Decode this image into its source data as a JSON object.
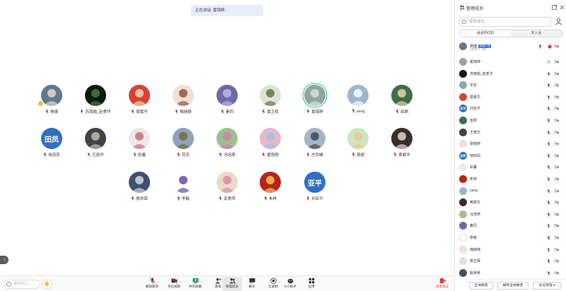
{
  "speaking_banner": "正在讲话: 夏锦婷;",
  "stage_tiles": [
    {
      "name": "杨捷",
      "mic": "muted",
      "avatar": {
        "kind": "photo",
        "bg": "#5e7a8f",
        "fg": "#e9d6c6"
      },
      "hand": true
    },
    {
      "name": "苏丽娟_赵季华",
      "mic": "on",
      "avatar": {
        "kind": "photo",
        "bg": "#0e1a10",
        "fg": "#3f7d3a"
      }
    },
    {
      "name": "梁慕华",
      "mic": "muted",
      "avatar": {
        "kind": "photo",
        "bg": "#d8432f",
        "fg": "#f3d3c0"
      }
    },
    {
      "name": "梅婉婧",
      "mic": "muted",
      "avatar": {
        "kind": "photo",
        "bg": "#f1dfd2",
        "fg": "#8a5a47"
      }
    },
    {
      "name": "秦同",
      "mic": "muted",
      "avatar": {
        "kind": "photo",
        "bg": "#6e6aa8",
        "fg": "#c3b7e0"
      }
    },
    {
      "name": "黄正辉",
      "mic": "muted",
      "avatar": {
        "kind": "photo",
        "bg": "#dfe3d6",
        "fg": "#5c7a3b"
      }
    },
    {
      "name": "夏锦婷",
      "mic": "on",
      "speaking": true,
      "avatar": {
        "kind": "photo",
        "bg": "#8fa7a0",
        "fg": "#d6e0d8"
      }
    },
    {
      "name": "yang",
      "mic": "muted",
      "avatar": {
        "kind": "photo",
        "bg": "#9cb7cf",
        "fg": "#ffffff"
      }
    },
    {
      "name": "巫刚",
      "mic": "muted",
      "avatar": {
        "kind": "photo",
        "bg": "#3d6f49",
        "fg": "#f1cfa8"
      }
    },
    {
      "name": "徐田凤",
      "mic": "muted",
      "avatar": {
        "kind": "text",
        "text": "田凤",
        "bg": "#2f6fc4"
      }
    },
    {
      "name": "王丽华",
      "mic": "muted",
      "avatar": {
        "kind": "photo",
        "bg": "#404447",
        "fg": "#c9b9a8"
      }
    },
    {
      "name": "彩馨",
      "mic": "muted",
      "avatar": {
        "kind": "photo",
        "bg": "#efe9e6",
        "fg": "#c56d7a"
      }
    },
    {
      "name": "花花",
      "mic": "muted",
      "avatar": {
        "kind": "photo",
        "bg": "#8aa4b8",
        "fg": "#7a6a3c"
      }
    },
    {
      "name": "冯培燕",
      "mic": "muted",
      "avatar": {
        "kind": "photo",
        "bg": "#9fbf8e",
        "fg": "#d77ca8"
      }
    },
    {
      "name": "童雨晴",
      "mic": "muted",
      "avatar": {
        "kind": "photo",
        "bg": "#e7b7c9",
        "fg": "#9bc5e2"
      }
    },
    {
      "name": "庄剑峰",
      "mic": "muted",
      "avatar": {
        "kind": "photo",
        "bg": "#a7b4c6",
        "fg": "#3d4856"
      }
    },
    {
      "name": "周超",
      "mic": "muted",
      "avatar": {
        "kind": "photo",
        "bg": "#cfe6c0",
        "fg": "#f2c590"
      }
    },
    {
      "name": "黄颖华",
      "mic": "muted",
      "avatar": {
        "kind": "photo",
        "bg": "#3a2d2b",
        "fg": "#e8d4c8"
      }
    },
    {
      "name": "殷世荣",
      "mic": "muted",
      "avatar": {
        "kind": "photo",
        "bg": "#3f4f6d",
        "fg": "#d5d9e3"
      }
    },
    {
      "name": "李敏",
      "mic": "muted",
      "avatar": {
        "kind": "photo",
        "bg": "#ffffff",
        "fg": "#6a4aa0"
      }
    },
    {
      "name": "武艳萍",
      "mic": "muted",
      "avatar": {
        "kind": "photo",
        "bg": "#eadbc9",
        "fg": "#e18aa2"
      }
    },
    {
      "name": "朱林",
      "mic": "muted",
      "avatar": {
        "kind": "photo",
        "bg": "#b82418",
        "fg": "#f0c75a"
      }
    },
    {
      "name": "刘亚平",
      "mic": "muted",
      "avatar": {
        "kind": "text",
        "text": "亚平",
        "bg": "#2f6fc4"
      }
    }
  ],
  "toolbar": {
    "chat_placeholder": "说点什么...",
    "buttons": [
      {
        "id": "unmute",
        "label": "解除静音",
        "icon": "mic-off-icon"
      },
      {
        "id": "video",
        "label": "开启视频",
        "icon": "camera-off-icon"
      },
      {
        "id": "share",
        "label": "共享屏幕",
        "icon": "share-screen-icon"
      },
      {
        "id": "invite",
        "label": "邀请",
        "icon": "add-user-icon"
      },
      {
        "id": "members",
        "label": "管理成员",
        "icon": "members-icon",
        "active": true
      },
      {
        "id": "chat",
        "label": "聊天",
        "icon": "chat-icon"
      },
      {
        "id": "record",
        "label": "云录制",
        "icon": "record-icon"
      },
      {
        "id": "ai",
        "label": "AI小助手",
        "icon": "ai-icon"
      },
      {
        "id": "apps",
        "label": "应用",
        "icon": "apps-icon"
      }
    ],
    "leave_label": "结束会议"
  },
  "panel": {
    "title": "管理成员",
    "search_placeholder": "搜索成员",
    "tab_in_meeting": "会议中(23)",
    "tab_not_joined": "未入会",
    "participants": [
      {
        "name": "杨捷",
        "badge": "家校入会",
        "role": "(主持人, 我)",
        "mic": "muted-red",
        "cam": "off",
        "av": {
          "bg": "#5e7a8f"
        }
      },
      {
        "name": "夏锦婷",
        "mic": "on-green",
        "cam": "off",
        "av": {
          "bg": "#8fa7a0"
        }
      },
      {
        "name": "苏丽娟_赵季华",
        "mic": "on",
        "cam": "off",
        "av": {
          "bg": "#0e1a10"
        }
      },
      {
        "name": "花花",
        "mic": "muted",
        "cam": "off",
        "av": {
          "bg": "#8aa4b8"
        }
      },
      {
        "name": "梁慕华",
        "mic": "muted",
        "cam": "off",
        "av": {
          "bg": "#d8432f"
        }
      },
      {
        "name": "刘亚平",
        "mic": "muted",
        "cam": "off",
        "av": {
          "bg": "#2f6fc4",
          "text": "亚平"
        }
      },
      {
        "name": "巫刚",
        "mic": "muted",
        "cam": "off",
        "av": {
          "bg": "#3d6f49"
        }
      },
      {
        "name": "王丽华",
        "mic": "muted",
        "cam": "off",
        "av": {
          "bg": "#404447"
        }
      },
      {
        "name": "梁婉婷",
        "mic": "muted",
        "cam": "off",
        "av": {
          "bg": "#f1dfd2"
        }
      },
      {
        "name": "徐田凤",
        "mic": "muted",
        "cam": "off",
        "av": {
          "bg": "#2f6fc4",
          "text": "田凤"
        }
      },
      {
        "name": "彩馨",
        "mic": "muted",
        "cam": "off",
        "av": {
          "bg": "#efe9e6"
        }
      },
      {
        "name": "朱林",
        "mic": "muted",
        "cam": "off",
        "av": {
          "bg": "#b82418"
        }
      },
      {
        "name": "yang",
        "mic": "muted",
        "cam": "off",
        "av": {
          "bg": "#9cb7cf"
        }
      },
      {
        "name": "黄颖华",
        "mic": "muted",
        "cam": "off",
        "av": {
          "bg": "#3a2d2b"
        }
      },
      {
        "name": "冯培燕",
        "mic": "muted",
        "cam": "off",
        "av": {
          "bg": "#9fbf8e"
        }
      },
      {
        "name": "秦同",
        "mic": "muted",
        "cam": "off",
        "av": {
          "bg": "#6e6aa8"
        }
      },
      {
        "name": "李敏",
        "mic": "muted",
        "cam": "off",
        "av": {
          "bg": "#ffffff"
        }
      },
      {
        "name": "梅婉婧",
        "mic": "muted",
        "cam": "off",
        "av": {
          "bg": "#f1dfd2"
        }
      },
      {
        "name": "黄正辉",
        "mic": "muted",
        "cam": "off",
        "av": {
          "bg": "#dfe3d6"
        }
      },
      {
        "name": "殷世荣",
        "mic": "muted",
        "cam": "off",
        "av": {
          "bg": "#3f4f6d"
        }
      }
    ],
    "footer": {
      "mute_all": "全体静音",
      "unmute_all": "解除全体静音",
      "manage": "会议管理"
    }
  },
  "colors": {
    "accent_blue": "#2f6ee8",
    "speaking_green": "#27c27c",
    "muted_red": "#e0393e",
    "banner_bg": "#e6eef9"
  }
}
